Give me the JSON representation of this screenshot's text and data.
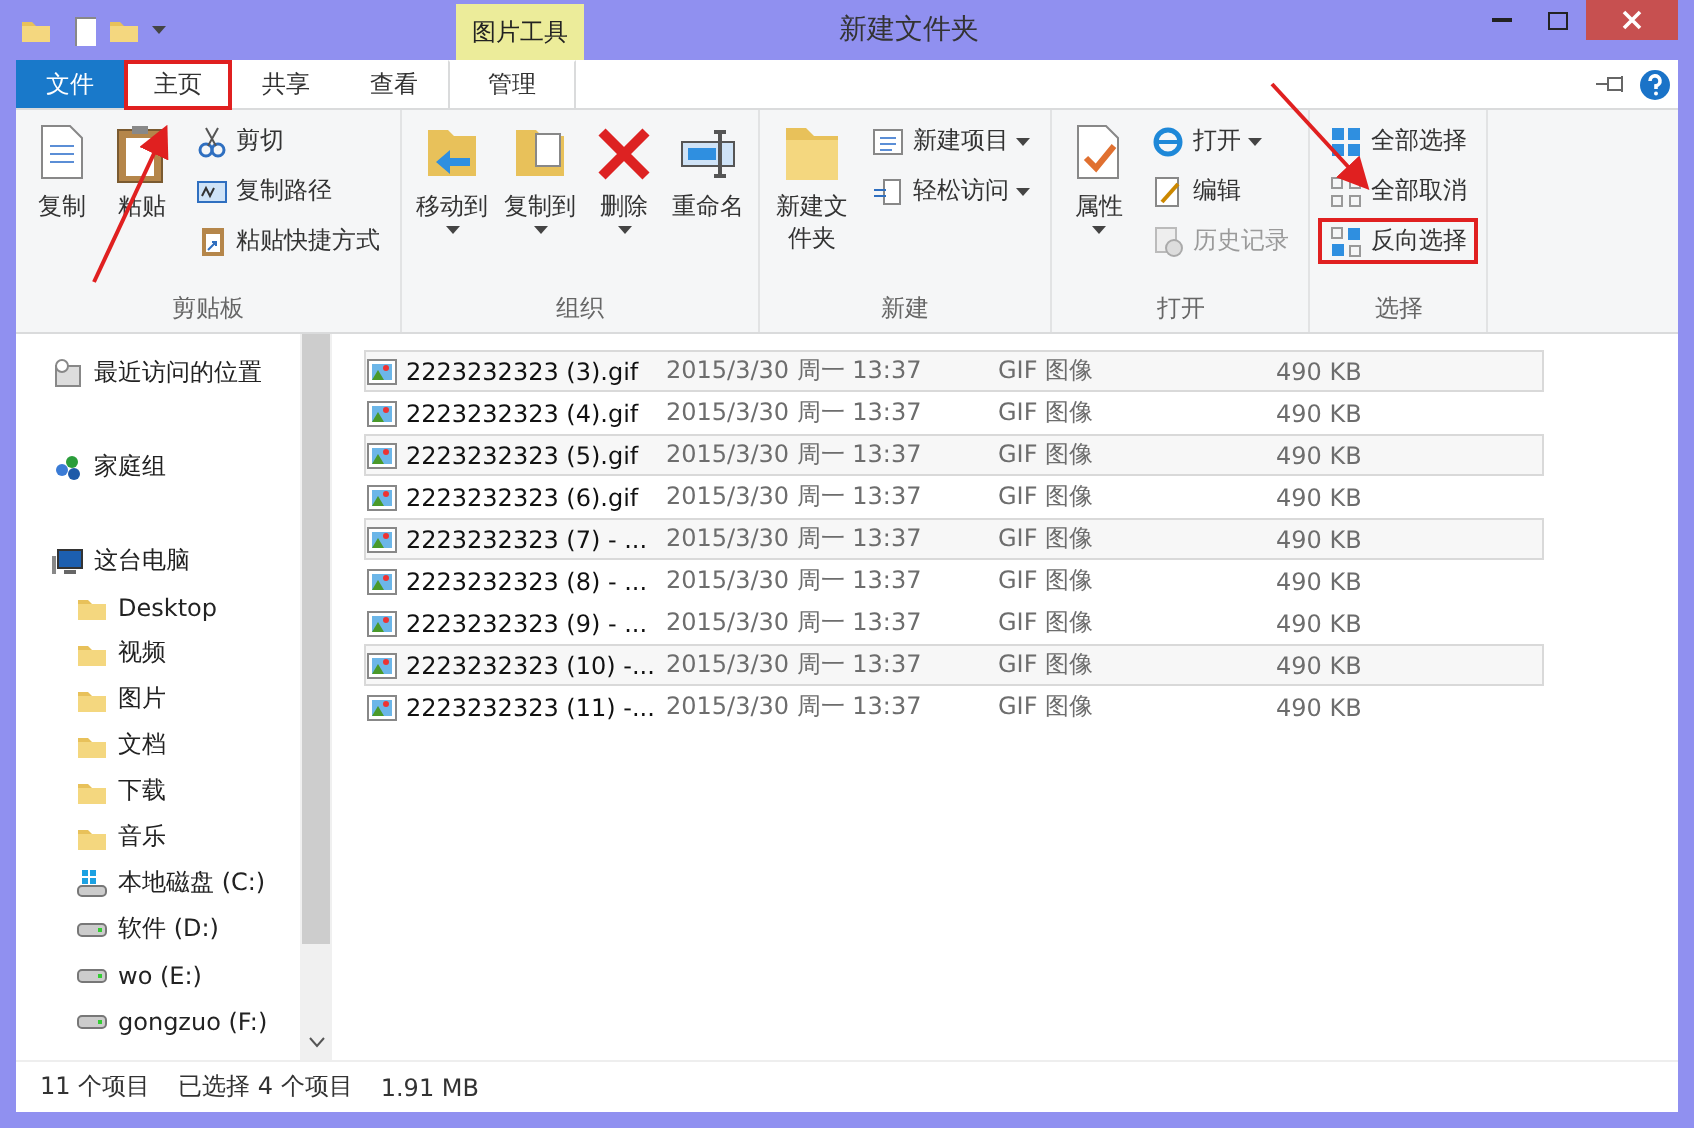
{
  "window": {
    "title": "新建文件夹",
    "context_tab": "图片工具"
  },
  "tabs": [
    {
      "label": "文件",
      "kind": "file",
      "selected": false,
      "highlighted": false
    },
    {
      "label": "主页",
      "kind": "tab",
      "selected": true,
      "highlighted": true
    },
    {
      "label": "共享",
      "kind": "tab",
      "selected": false,
      "highlighted": false
    },
    {
      "label": "查看",
      "kind": "tab",
      "selected": false,
      "highlighted": false
    },
    {
      "label": "管理",
      "kind": "context",
      "selected": false,
      "highlighted": false
    }
  ],
  "ribbon": [
    {
      "label": "剪贴板",
      "big": [
        {
          "label": "复制",
          "menu": false
        },
        {
          "label": "粘贴",
          "menu": false
        }
      ],
      "small": [
        {
          "label": "剪切",
          "menu": false,
          "disabled": false,
          "highlighted": false
        },
        {
          "label": "复制路径",
          "menu": false,
          "disabled": false,
          "highlighted": false
        },
        {
          "label": "粘贴快捷方式",
          "menu": false,
          "disabled": false,
          "highlighted": false
        }
      ]
    },
    {
      "label": "组织",
      "big": [
        {
          "label": "移动到",
          "menu": true
        },
        {
          "label": "复制到",
          "menu": true
        },
        {
          "label": "删除",
          "menu": true
        },
        {
          "label": "重命名",
          "menu": false
        }
      ]
    },
    {
      "label": "新建",
      "big": [
        {
          "label": "新建文件夹",
          "menu": false
        }
      ],
      "small": [
        {
          "label": "新建项目",
          "menu": true,
          "disabled": false,
          "highlighted": false
        },
        {
          "label": "轻松访问",
          "menu": true,
          "disabled": false,
          "highlighted": false
        }
      ]
    },
    {
      "label": "打开",
      "big": [
        {
          "label": "属性",
          "menu": true
        }
      ],
      "small": [
        {
          "label": "打开",
          "menu": true,
          "disabled": false,
          "highlighted": false
        },
        {
          "label": "编辑",
          "menu": false,
          "disabled": false,
          "highlighted": false
        },
        {
          "label": "历史记录",
          "menu": false,
          "disabled": true,
          "highlighted": false
        }
      ]
    },
    {
      "label": "选择",
      "small": [
        {
          "label": "全部选择",
          "menu": false,
          "disabled": false,
          "highlighted": false
        },
        {
          "label": "全部取消",
          "menu": false,
          "disabled": false,
          "highlighted": false
        },
        {
          "label": "反向选择",
          "menu": false,
          "disabled": false,
          "highlighted": true
        }
      ]
    }
  ],
  "nav": [
    {
      "label": "最近访问的位置",
      "kind": "recent"
    },
    {
      "label": "家庭组",
      "kind": "homegroup"
    },
    {
      "label": "这台电脑",
      "kind": "pc",
      "children": [
        {
          "label": "Desktop",
          "kind": "folder"
        },
        {
          "label": "视频",
          "kind": "folder"
        },
        {
          "label": "图片",
          "kind": "folder"
        },
        {
          "label": "文档",
          "kind": "folder"
        },
        {
          "label": "下载",
          "kind": "folder"
        },
        {
          "label": "音乐",
          "kind": "folder"
        },
        {
          "label": "本地磁盘 (C:)",
          "kind": "sysdrive"
        },
        {
          "label": "软件 (D:)",
          "kind": "drive"
        },
        {
          "label": "wo (E:)",
          "kind": "drive"
        },
        {
          "label": "gongzuo (F:)",
          "kind": "drive"
        }
      ]
    }
  ],
  "files": [
    {
      "name": "2223232323 (3).gif",
      "date": "2015/3/30 周一 13:37",
      "type": "GIF 图像",
      "size": "490 KB",
      "selected": true
    },
    {
      "name": "2223232323 (4).gif",
      "date": "2015/3/30 周一 13:37",
      "type": "GIF 图像",
      "size": "490 KB",
      "selected": false
    },
    {
      "name": "2223232323 (5).gif",
      "date": "2015/3/30 周一 13:37",
      "type": "GIF 图像",
      "size": "490 KB",
      "selected": true
    },
    {
      "name": "2223232323 (6).gif",
      "date": "2015/3/30 周一 13:37",
      "type": "GIF 图像",
      "size": "490 KB",
      "selected": false
    },
    {
      "name": "2223232323 (7) - ...",
      "date": "2015/3/30 周一 13:37",
      "type": "GIF 图像",
      "size": "490 KB",
      "selected": true
    },
    {
      "name": "2223232323 (8) - ...",
      "date": "2015/3/30 周一 13:37",
      "type": "GIF 图像",
      "size": "490 KB",
      "selected": false
    },
    {
      "name": "2223232323 (9) - ...",
      "date": "2015/3/30 周一 13:37",
      "type": "GIF 图像",
      "size": "490 KB",
      "selected": false
    },
    {
      "name": "2223232323 (10) -...",
      "date": "2015/3/30 周一 13:37",
      "type": "GIF 图像",
      "size": "490 KB",
      "selected": true
    },
    {
      "name": "2223232323 (11) -...",
      "date": "2015/3/30 周一 13:37",
      "type": "GIF 图像",
      "size": "490 KB",
      "selected": false
    }
  ],
  "status_bar": {
    "count": "11 个项目",
    "selection": "已选择 4 个项目",
    "size": "1.91 MB"
  }
}
